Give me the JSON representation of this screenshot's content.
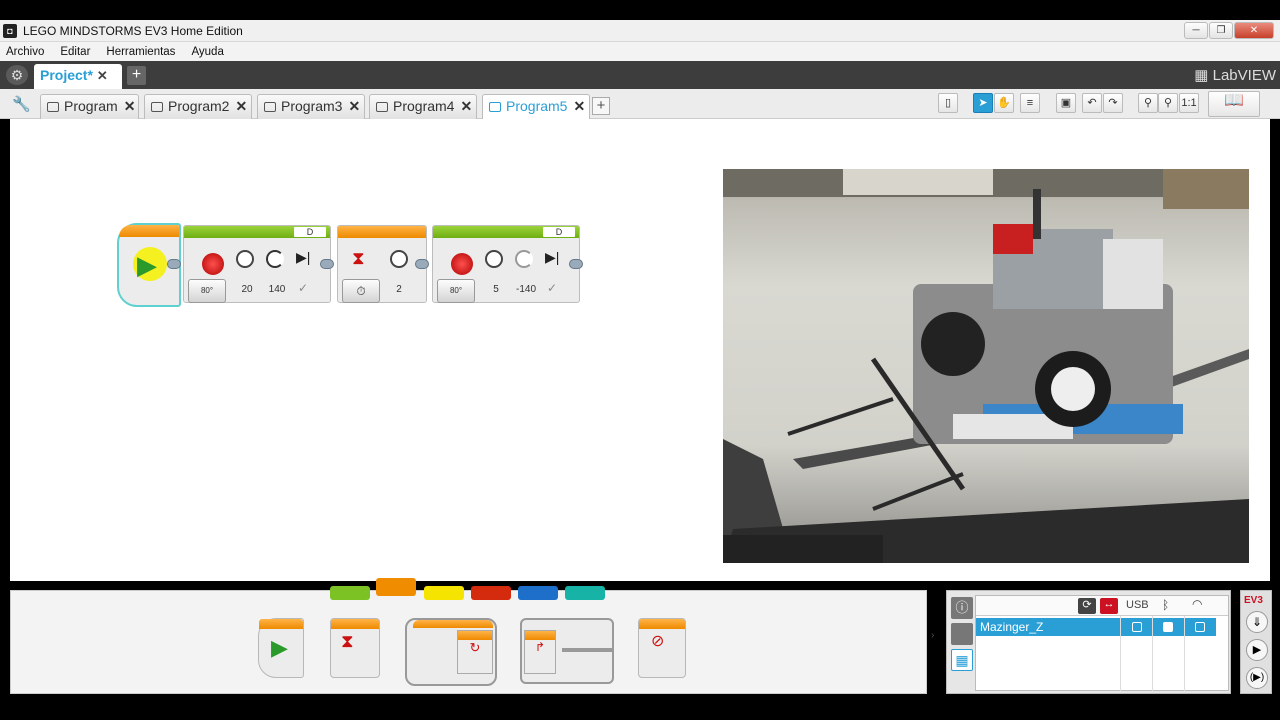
{
  "window": {
    "title": "LEGO MINDSTORMS EV3 Home Edition",
    "controls": [
      "─",
      "❐",
      "✕"
    ]
  },
  "menu": [
    "Archivo",
    "Editar",
    "Herramientas",
    "Ayuda"
  ],
  "project": {
    "tab_label": "Project*",
    "close": "✕",
    "add": "+",
    "brand": "LabVIEW"
  },
  "program_tabs": [
    {
      "label": "Program",
      "active": false
    },
    {
      "label": "Program2",
      "active": false
    },
    {
      "label": "Program3",
      "active": false
    },
    {
      "label": "Program4",
      "active": false
    },
    {
      "label": "Program5",
      "active": true
    }
  ],
  "toolbar_icons": [
    "content-editor-icon",
    "select-pointer-icon",
    "pan-hand-icon",
    "comment-icon",
    "save-icon",
    "undo-icon",
    "redo-icon",
    "zoom-out-icon",
    "zoom-in-icon",
    "zoom-reset-icon",
    "lobby-book-icon"
  ],
  "toolbar": {
    "zoom_reset": "1:1"
  },
  "program_blocks": {
    "motor1": {
      "port": "D",
      "mode": "80°",
      "power": "20",
      "degrees": "140"
    },
    "wait": {
      "mode": "⏱",
      "seconds": "2"
    },
    "motor2": {
      "port": "D",
      "mode": "80°",
      "power": "5",
      "degrees": "-140"
    }
  },
  "palette": {
    "categories": [
      {
        "name": "action",
        "color": "#7cc224"
      },
      {
        "name": "flow-control",
        "color": "#f08c00"
      },
      {
        "name": "sensor",
        "color": "#f5e400"
      },
      {
        "name": "data-operations",
        "color": "#d42a0e"
      },
      {
        "name": "advanced",
        "color": "#1d6fc9"
      },
      {
        "name": "my-blocks",
        "color": "#17b3a6"
      }
    ],
    "blocks": [
      "start-block",
      "wait-block",
      "loop-block",
      "switch-block",
      "loop-interrupt-block"
    ]
  },
  "hardware": {
    "brick_name": "Mazinger_Z",
    "columns": [
      "USB"
    ],
    "side_label": "EV3"
  }
}
